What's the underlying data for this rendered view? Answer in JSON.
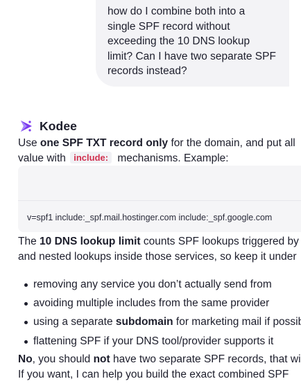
{
  "user_message": {
    "lines": [
      "how do I combine both into a",
      "single SPF record without",
      "exceeding the 10 DNS lookup",
      "limit? Can I have two separate SPF",
      "records instead?"
    ]
  },
  "assistant": {
    "name": "Kodee",
    "p1": {
      "t1": "Use ",
      "b1": "one SPF TXT record only",
      "t2": " for the domain, and put all",
      "t3": "value with ",
      "code": "include:",
      "t4": " mechanisms. Example:"
    },
    "code_block": {
      "text": "v=spf1 include:_spf.mail.hostinger.com include:_spf.google.com"
    },
    "p2": {
      "t1": "The ",
      "b1": "10 DNS lookup limit",
      "t2": " counts SPF lookups triggered by",
      "t3": "and nested lookups inside those services, so keep it under"
    },
    "bullets": [
      {
        "text": "removing any service you don’t actually send from"
      },
      {
        "text": "avoiding multiple includes from the same provider"
      },
      {
        "pre": "using a separate ",
        "bold": "subdomain",
        "post": " for marketing mail if possible"
      },
      {
        "text": "flattening SPF if your DNS tool/provider supports it"
      }
    ],
    "p3": {
      "b1": "No",
      "t1": ", you should ",
      "b2": "not",
      "t2": " have two separate SPF records, that will",
      "t3": "If you want, I can help you build the exact combined SPF"
    }
  },
  "colors": {
    "accent": "#7c3aed",
    "inline_code": "#d1314f",
    "bubble_bg": "#f3f3f6"
  }
}
